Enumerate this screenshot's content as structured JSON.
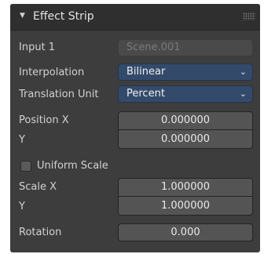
{
  "panel": {
    "title": "Effect Strip",
    "collapse_icon": "triangle-down-icon",
    "drag_handle_icon": "grip-dots-icon"
  },
  "input1": {
    "label": "Input 1",
    "value": "Scene.001"
  },
  "interpolation": {
    "label": "Interpolation",
    "value": "Bilinear"
  },
  "translation_unit": {
    "label": "Translation Unit",
    "value": "Percent"
  },
  "position": {
    "label_x": "Position X",
    "label_y": "Y",
    "x": "0.000000",
    "y": "0.000000"
  },
  "uniform_scale": {
    "label": "Uniform Scale",
    "checked": false
  },
  "scale": {
    "label_x": "Scale X",
    "label_y": "Y",
    "x": "1.000000",
    "y": "1.000000"
  },
  "rotation": {
    "label": "Rotation",
    "value": "0.000"
  },
  "icons": {
    "dropdown": "chevron-down-icon"
  },
  "colors": {
    "panel_bg": "#3d3d3d",
    "header_bg": "#2f2f2f",
    "select_bg": "#334a6b",
    "field_bg": "#545454"
  }
}
